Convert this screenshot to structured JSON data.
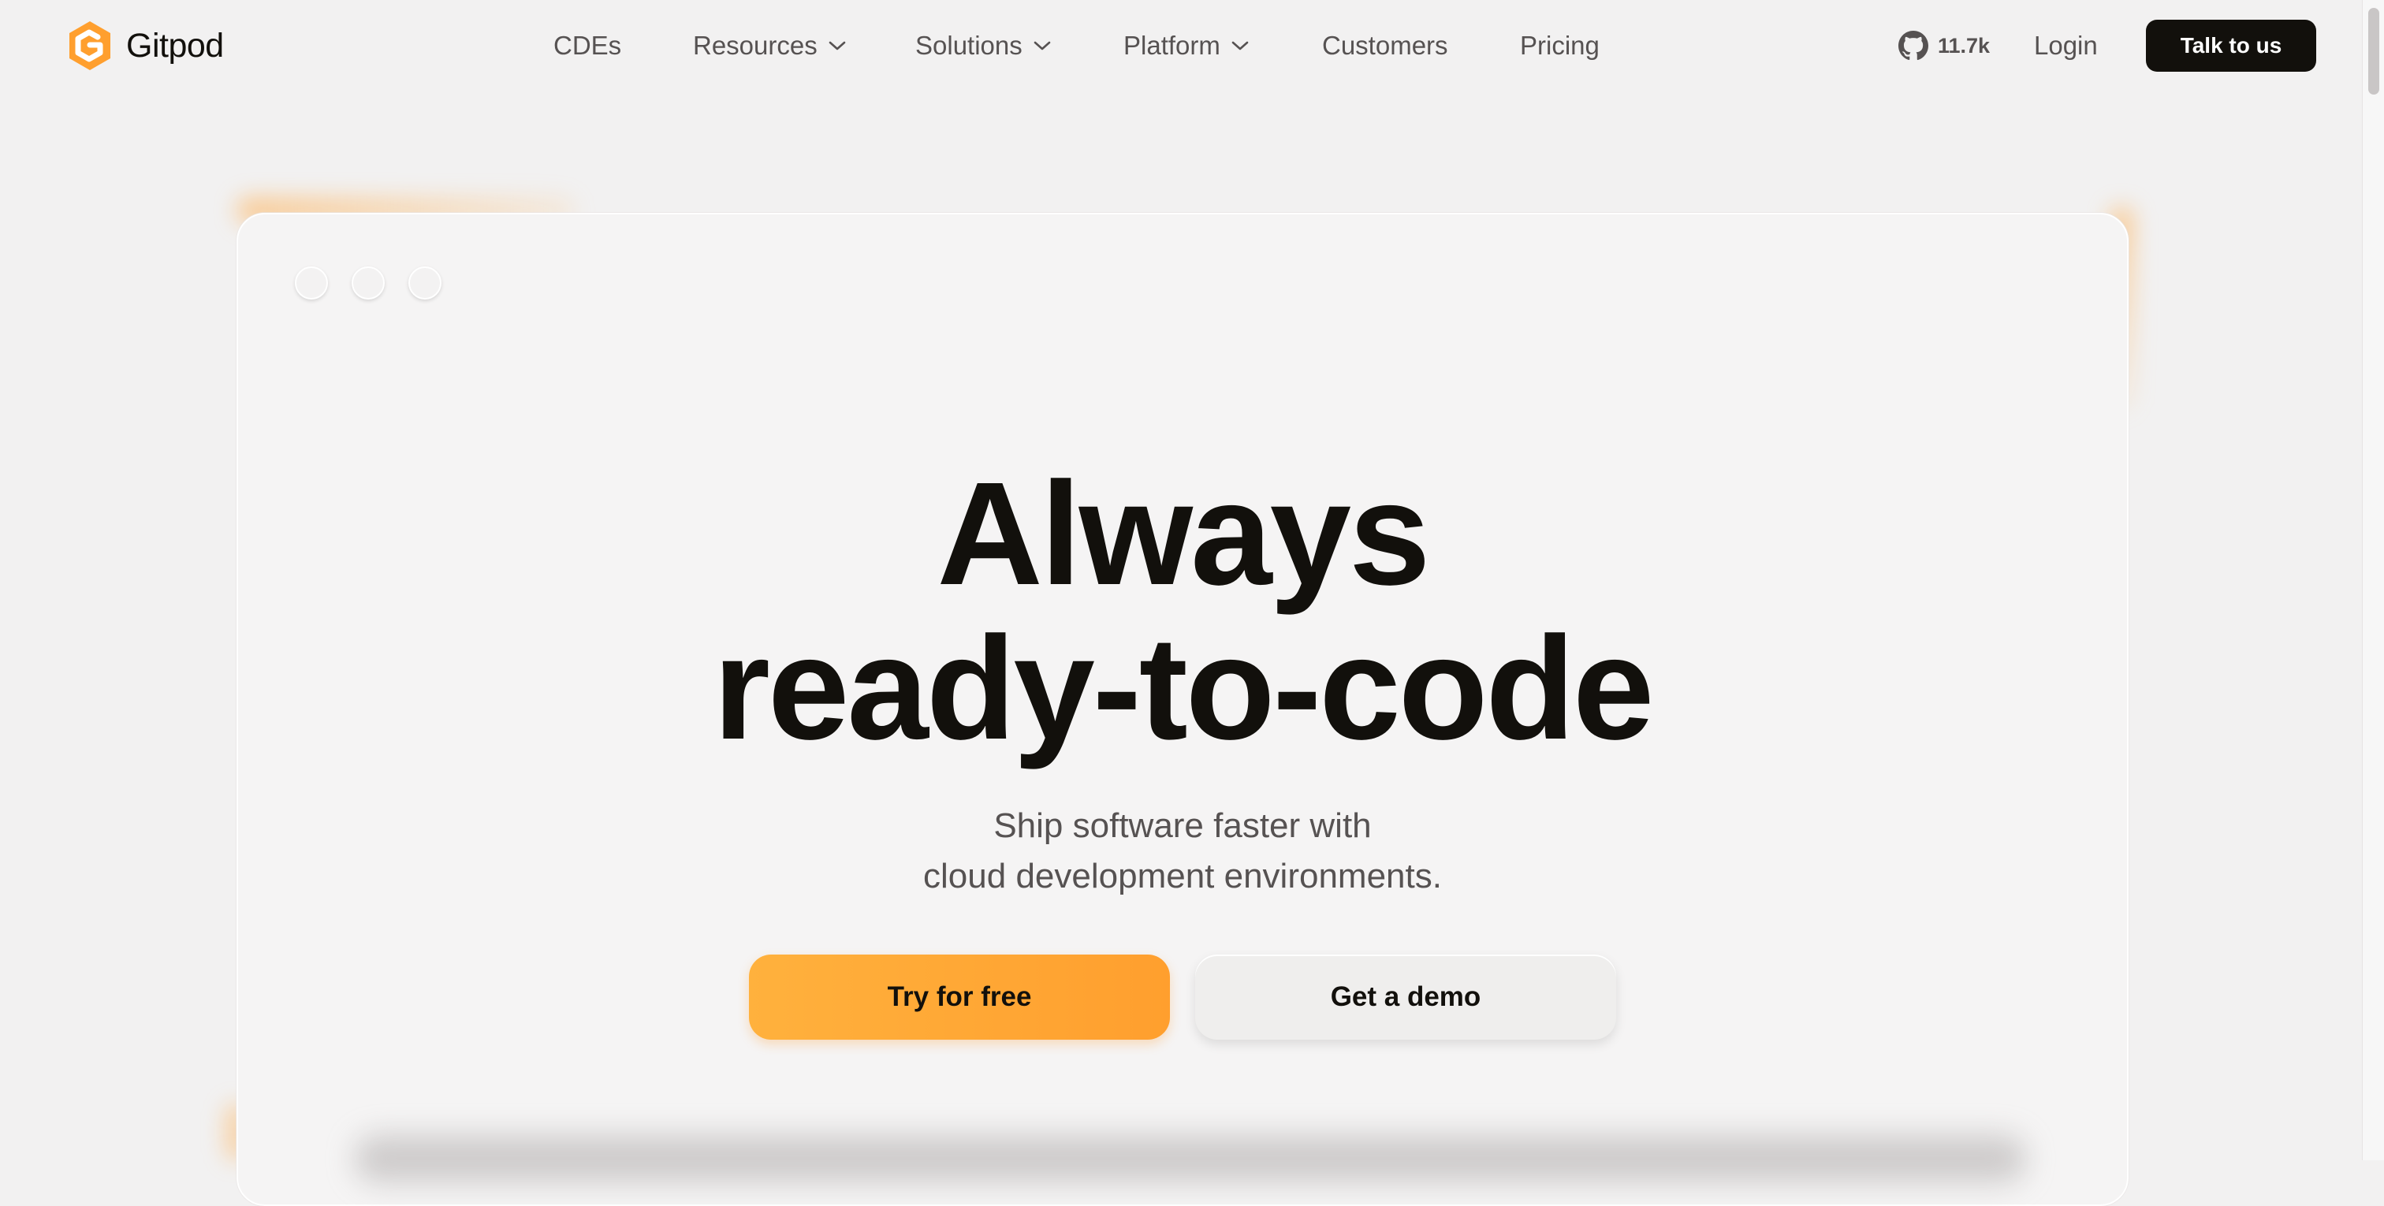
{
  "brand": {
    "name": "Gitpod",
    "accent": "#ff9f2e",
    "text_color": "#12100c"
  },
  "nav": {
    "items": [
      {
        "label": "CDEs",
        "has_dropdown": false
      },
      {
        "label": "Resources",
        "has_dropdown": true
      },
      {
        "label": "Solutions",
        "has_dropdown": true
      },
      {
        "label": "Platform",
        "has_dropdown": true
      },
      {
        "label": "Customers",
        "has_dropdown": false
      },
      {
        "label": "Pricing",
        "has_dropdown": false
      }
    ]
  },
  "header": {
    "github_stars": "11.7k",
    "login_label": "Login",
    "cta_label": "Talk to us"
  },
  "hero": {
    "title_line1": "Always",
    "title_line2": "ready-to-code",
    "subtitle_line1": "Ship software faster with",
    "subtitle_line2": "cloud development environments.",
    "primary_cta": "Try for free",
    "secondary_cta": "Get a demo"
  },
  "icons": {
    "logo": "gitpod-logo-icon",
    "github": "github-icon",
    "dropdown": "chevron-down-icon"
  }
}
